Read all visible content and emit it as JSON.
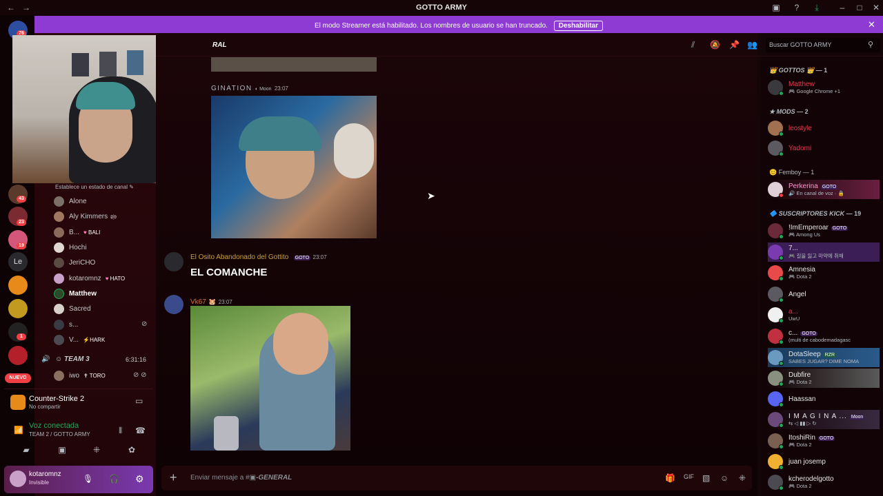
{
  "window": {
    "title": "GOTTO ARMY"
  },
  "banner": {
    "message": "El modo Streamer está habilitado. Los nombres de usuario se han truncado.",
    "button": "Deshabilitar"
  },
  "servers": {
    "badges": [
      "76",
      "43",
      "23",
      "19",
      "1"
    ],
    "le_label": "Le",
    "new_label": "NUEVO"
  },
  "channel": {
    "header_fragment": "RAL",
    "status_prompt": "Establece un estado de canal",
    "voice_members": [
      {
        "name": "Alone",
        "tag": ""
      },
      {
        "name": "Aly Kimmers",
        "tag": "ᴅ҉ᴏ"
      },
      {
        "name": "B...",
        "tag": "BALI"
      },
      {
        "name": "Hochi",
        "tag": ""
      },
      {
        "name": "JeriCHO",
        "tag": ""
      },
      {
        "name": "kotaromnz",
        "tag": "HATO"
      },
      {
        "name": "Matthew",
        "tag": ""
      },
      {
        "name": "Sacred",
        "tag": ""
      },
      {
        "name": "s...",
        "tag": ""
      },
      {
        "name": "V...",
        "tag": "HARK"
      }
    ],
    "team3": {
      "name": "TEAM 3",
      "timer": "6:31:16"
    },
    "team3_member": {
      "name": "iwo",
      "tag": "TORO"
    },
    "activity": {
      "game": "Counter-Strike 2",
      "status": "No compartir"
    },
    "voice": {
      "status": "Voz conectada",
      "location": "TEAM 2 / GOTTO ARMY"
    },
    "user": {
      "name": "kotaromnz",
      "status": "Invisible"
    }
  },
  "chat": {
    "search_placeholder": "Buscar GOTTO ARMY",
    "messages": [
      {
        "author": "GINATION",
        "tag": "Moon",
        "time": "23:07"
      },
      {
        "author": "El Osito Abandonado del Gottito",
        "tag": "GOTO",
        "time": "23:07",
        "text": "EL COMANCHE"
      },
      {
        "author": "Vk67",
        "tag": "",
        "time": "23:07"
      }
    ],
    "input_placeholder": "Enviar mensaje a #",
    "input_channel": "-GENERAL"
  },
  "member_list": {
    "categories": [
      {
        "name": "GOTTOS",
        "count": "— 1"
      },
      {
        "name": "MODS",
        "count": "— 2"
      },
      {
        "name": "Femboy",
        "count": "— 1"
      },
      {
        "name": "SUSCRIPTORES KICK",
        "count": "— 19"
      }
    ],
    "members": [
      {
        "name": "Matthew",
        "sub": "Google Chrome +1",
        "tag": ""
      },
      {
        "name": "leostyle",
        "sub": "",
        "tag": ""
      },
      {
        "name": "Yadomi",
        "sub": "",
        "tag": ""
      },
      {
        "name": "Perkerina",
        "sub": "En canal de voz",
        "tag": "GOTO"
      },
      {
        "name": "!ImEmperoar",
        "sub": "Among Us",
        "tag": "GOTO"
      },
      {
        "name": "7...",
        "sub": "길을 잃고 마약에 취해",
        "tag": ""
      },
      {
        "name": "Amnesia",
        "sub": "Dota 2",
        "tag": ""
      },
      {
        "name": "Angel",
        "sub": "",
        "tag": ""
      },
      {
        "name": "a...",
        "sub": "UwU",
        "tag": ""
      },
      {
        "name": "c...",
        "sub": "(multi de cabodemadagasc",
        "tag": "GOTO"
      },
      {
        "name": "DotaSleep",
        "sub": "SABES JUGAR? DIME NOMA",
        "tag": "RZR"
      },
      {
        "name": "Dubfire",
        "sub": "Dota 2",
        "tag": ""
      },
      {
        "name": "Haassan",
        "sub": "",
        "tag": ""
      },
      {
        "name": "I M A G I N A ...",
        "sub": "",
        "tag": "Moon"
      },
      {
        "name": "ItoshiRin",
        "sub": "Dota 2",
        "tag": "GOTO"
      },
      {
        "name": "juan josemp",
        "sub": "",
        "tag": ""
      },
      {
        "name": "kcherodelgotto",
        "sub": "Dota 2",
        "tag": ""
      }
    ]
  },
  "colors": {
    "banner": "#8e3bd3",
    "accent_red": "#f23f43",
    "online": "#23a55a",
    "mod_name": "#e8384f"
  }
}
